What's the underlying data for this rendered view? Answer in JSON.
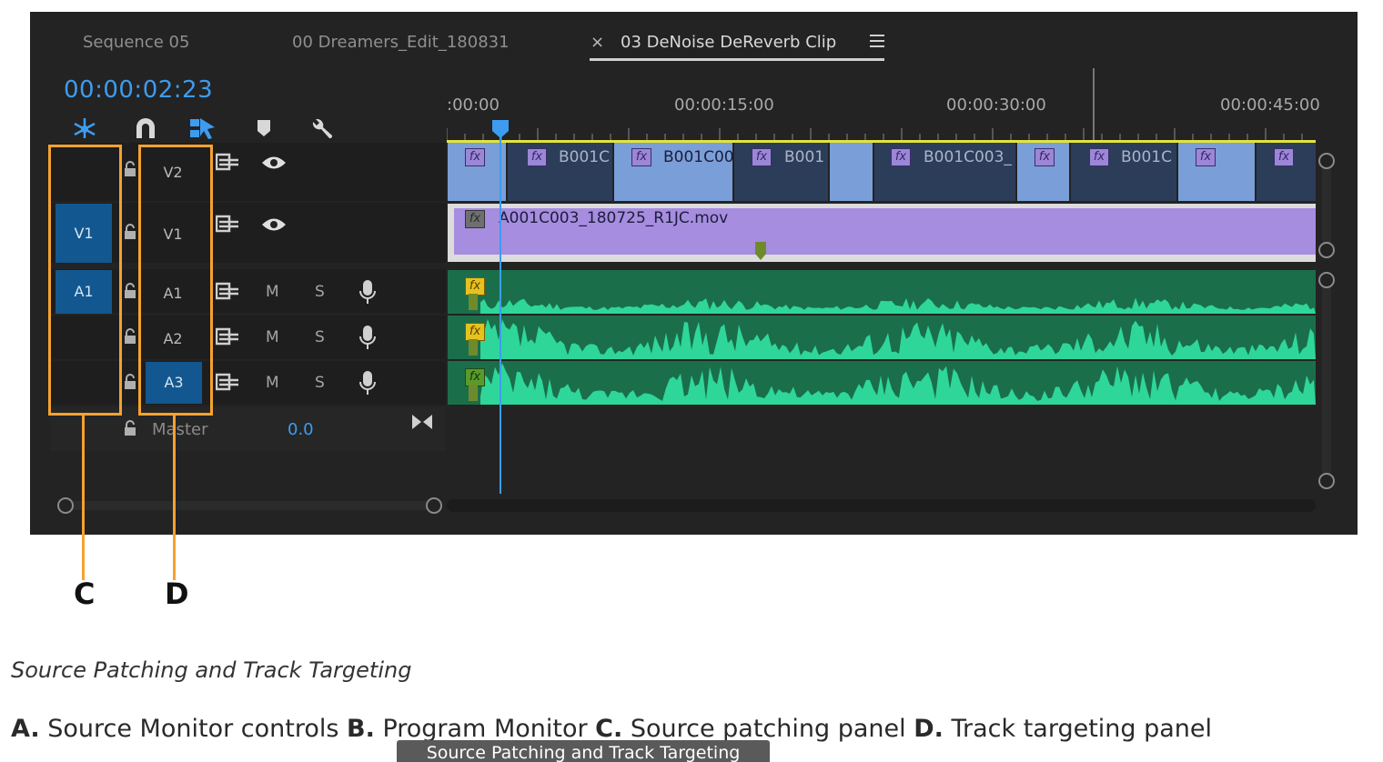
{
  "tabs": [
    {
      "label": "Sequence 05"
    },
    {
      "label": "00 Dreamers_Edit_180831"
    },
    {
      "label": "03 DeNoise DeReverb Clip",
      "close": "×"
    }
  ],
  "timecode": "00:00:02:23",
  "ruler": [
    ":00:00",
    "00:00:15:00",
    "00:00:30:00",
    "00:00:45:00"
  ],
  "tracks": {
    "v2": {
      "label": "V2"
    },
    "v1": {
      "label": "V1",
      "patch": "V1"
    },
    "a1": {
      "label": "A1",
      "patch": "A1",
      "m": "M",
      "s": "S"
    },
    "a2": {
      "label": "A2",
      "m": "M",
      "s": "S"
    },
    "a3": {
      "label": "A3",
      "m": "M",
      "s": "S"
    },
    "master": {
      "label": "Master",
      "value": "0.0"
    }
  },
  "v2_clips": [
    "B001C",
    "B001C00",
    "B001",
    "B001C003_",
    "B001C"
  ],
  "fx": "fx",
  "v1_clip": "A001C003_180725_R1JC.mov",
  "callouts": {
    "c": "C",
    "d": "D"
  },
  "caption": {
    "title": "Source Patching and Track Targeting",
    "a_key": "A.",
    "a_text": " Source Monitor controls ",
    "b_key": "B.",
    "b_text": " Program Monitor ",
    "c_key": "C.",
    "c_text": " Source patching panel ",
    "d_key": "D.",
    "d_text": " Track targeting panel"
  },
  "tooltip": "Source Patching and Track Targeting",
  "colors": {
    "accent_blue": "#3d9cf0",
    "callout_orange": "#f5a230",
    "audio_green": "#2ed69a",
    "v1_purple": "#a68de0"
  }
}
